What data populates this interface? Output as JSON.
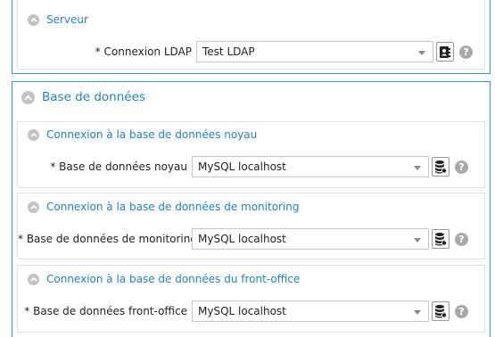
{
  "server_section": {
    "title": "Serveur",
    "ldap": {
      "label": "* Connexion LDAP",
      "value": "Test LDAP"
    }
  },
  "database_section": {
    "title": "Base de données",
    "groups": [
      {
        "title": "Connexion à la base de données noyau",
        "label": "* Base de données noyau",
        "value": "MySQL localhost"
      },
      {
        "title": "Connexion à la base de données de monitoring",
        "label": "* Base de données de monitoring",
        "value": "MySQL localhost"
      },
      {
        "title": "Connexion à la base de données du front-office",
        "label": "* Base de données front-office",
        "value": "MySQL localhost"
      }
    ]
  },
  "help_glyph": "?",
  "icons": {
    "collapse": "chevron-up-icon",
    "ldap_action": "address-book-icon",
    "db_action": "database-icon",
    "help": "help-icon"
  },
  "colors": {
    "accent": "#2a9fd6",
    "link": "#1a86c2",
    "icon_gray": "#c3c3c3"
  }
}
